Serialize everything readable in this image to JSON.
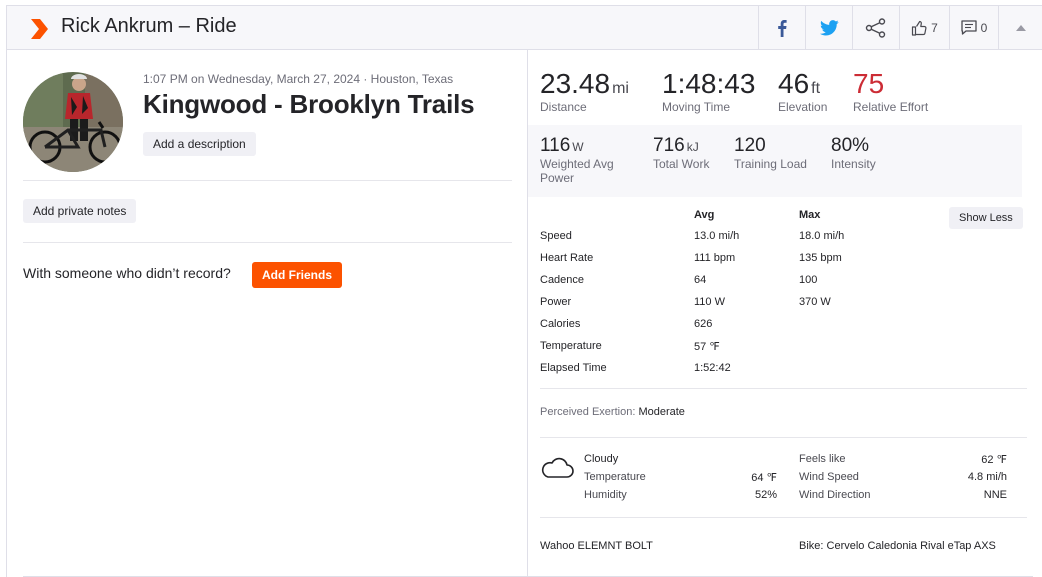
{
  "header": {
    "title": "Rick Ankrum – Ride",
    "kudos_count": "7",
    "comment_count": "0"
  },
  "activity": {
    "meta": "1:07 PM on Wednesday, March 27, 2024 · Houston, Texas",
    "name": "Kingwood - Brooklyn Trails",
    "add_description_label": "Add a description",
    "add_private_notes_label": "Add private notes",
    "with_someone_text": "With someone who didn’t record?",
    "add_friends_label": "Add Friends"
  },
  "primary_stats": [
    {
      "value": "23.48",
      "unit": "mi",
      "label": "Distance"
    },
    {
      "value": "1:48:43",
      "unit": "",
      "label": "Moving Time"
    },
    {
      "value": "46",
      "unit": "ft",
      "label": "Elevation"
    },
    {
      "value": "75",
      "unit": "",
      "label": "Relative Effort"
    }
  ],
  "secondary_stats": [
    {
      "value": "116",
      "unit": "W",
      "label": "Weighted Avg Power"
    },
    {
      "value": "716",
      "unit": "kJ",
      "label": "Total Work"
    },
    {
      "value": "120",
      "unit": "",
      "label": "Training Load"
    },
    {
      "value": "80%",
      "unit": "",
      "label": "Intensity"
    }
  ],
  "details": {
    "avg_header": "Avg",
    "max_header": "Max",
    "show_less_label": "Show Less",
    "rows": [
      {
        "label": "Speed",
        "avg": "13.0 mi/h",
        "max": "18.0 mi/h"
      },
      {
        "label": "Heart Rate",
        "avg": "111 bpm",
        "max": "135 bpm"
      },
      {
        "label": "Cadence",
        "avg": "64",
        "max": "100"
      },
      {
        "label": "Power",
        "avg": "110 W",
        "max": "370 W"
      },
      {
        "label": "Calories",
        "avg": "626",
        "max": ""
      },
      {
        "label": "Temperature",
        "avg": "57 ℉",
        "max": ""
      },
      {
        "label": "Elapsed Time",
        "avg": "1:52:42",
        "max": ""
      }
    ]
  },
  "perceived_exertion": {
    "label": "Perceived Exertion:",
    "value": "Moderate"
  },
  "weather": {
    "condition": "Cloudy",
    "temperature_label": "Temperature",
    "temperature": "64 ℉",
    "humidity_label": "Humidity",
    "humidity": "52%",
    "feels_like_label": "Feels like",
    "feels_like": "62 ℉",
    "wind_speed_label": "Wind Speed",
    "wind_speed": "4.8 mi/h",
    "wind_direction_label": "Wind Direction",
    "wind_direction": "NNE"
  },
  "gear": {
    "device": "Wahoo ELEMNT BOLT",
    "bike": "Bike: Cervelo Caledonia Rival eTap AXS"
  },
  "colors": {
    "brand": "#fc5200",
    "relative_effort": "#cc2c35",
    "facebook": "#3b5998",
    "twitter": "#1da1f2"
  }
}
